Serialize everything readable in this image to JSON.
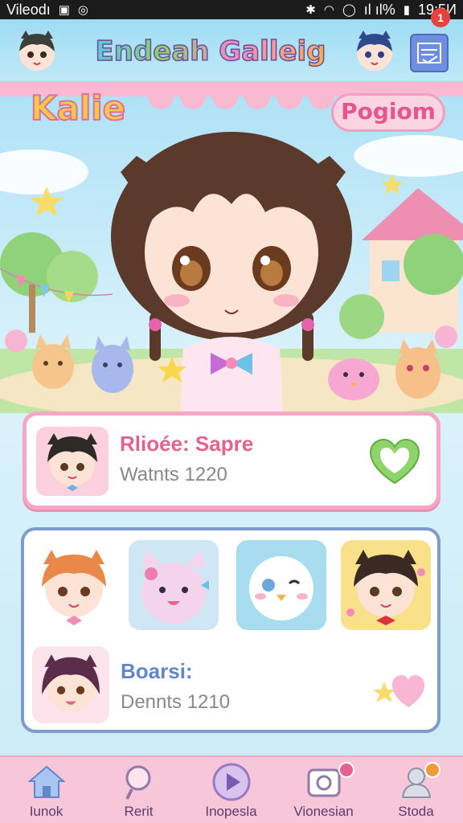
{
  "status_bar": {
    "carrier": "Vileodı",
    "signal_text": "ıl ıl%",
    "time": "19:5И"
  },
  "header": {
    "title": "Endeah Galleig",
    "notification_count": "1"
  },
  "banner": {
    "name": "Kalie",
    "button_label": "Pogiom"
  },
  "featured": {
    "name": "Rlioée: Sapre",
    "stat": "Watnts 1220",
    "liked": true
  },
  "gallery": {
    "name": "Boarsi:",
    "stat": "Dennts 1210"
  },
  "nav": {
    "items": [
      {
        "label": "Iunok",
        "icon": "home-icon"
      },
      {
        "label": "Rerit",
        "icon": "search-icon"
      },
      {
        "label": "Inopesla",
        "icon": "play-icon"
      },
      {
        "label": "Vionesian",
        "icon": "gallery-icon"
      },
      {
        "label": "Stoda",
        "icon": "profile-icon"
      }
    ]
  },
  "colors": {
    "accent_pink": "#f7a6c3",
    "accent_blue": "#7f9bc8",
    "heart_green": "#8fd46a",
    "nav_bg": "#f7c7d9"
  }
}
